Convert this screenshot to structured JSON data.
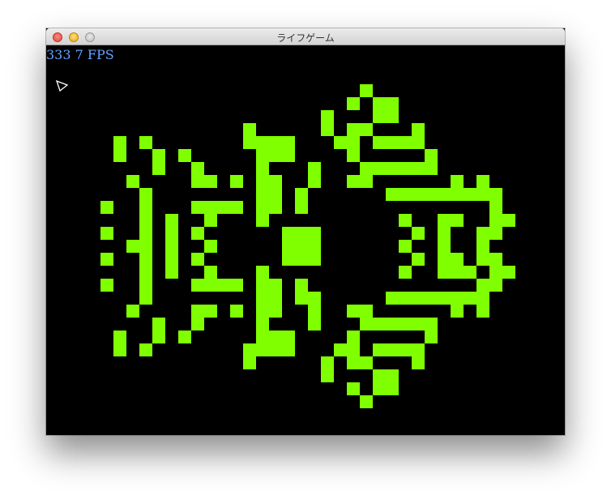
{
  "window": {
    "title": "ライフゲーム"
  },
  "hud": {
    "count": "333",
    "fps": "7 FPS"
  },
  "game": {
    "cell_color": "#80ff00",
    "background_color": "#000000",
    "live_cells": [
      [
        24,
        3
      ],
      [
        23,
        4
      ],
      [
        25,
        4
      ],
      [
        26,
        4
      ],
      [
        21,
        5
      ],
      [
        25,
        5
      ],
      [
        26,
        5
      ],
      [
        15,
        6
      ],
      [
        21,
        6
      ],
      [
        23,
        6
      ],
      [
        24,
        6
      ],
      [
        28,
        6
      ],
      [
        5,
        7
      ],
      [
        7,
        7
      ],
      [
        15,
        7
      ],
      [
        16,
        7
      ],
      [
        17,
        7
      ],
      [
        18,
        7
      ],
      [
        22,
        7
      ],
      [
        23,
        7
      ],
      [
        25,
        7
      ],
      [
        26,
        7
      ],
      [
        27,
        7
      ],
      [
        28,
        7
      ],
      [
        5,
        8
      ],
      [
        8,
        8
      ],
      [
        10,
        8
      ],
      [
        16,
        8
      ],
      [
        17,
        8
      ],
      [
        18,
        8
      ],
      [
        23,
        8
      ],
      [
        29,
        8
      ],
      [
        8,
        9
      ],
      [
        11,
        9
      ],
      [
        16,
        9
      ],
      [
        20,
        9
      ],
      [
        24,
        9
      ],
      [
        25,
        9
      ],
      [
        26,
        9
      ],
      [
        27,
        9
      ],
      [
        28,
        9
      ],
      [
        29,
        9
      ],
      [
        6,
        10
      ],
      [
        11,
        10
      ],
      [
        12,
        10
      ],
      [
        14,
        10
      ],
      [
        16,
        10
      ],
      [
        17,
        10
      ],
      [
        20,
        10
      ],
      [
        23,
        10
      ],
      [
        24,
        10
      ],
      [
        31,
        10
      ],
      [
        33,
        10
      ],
      [
        7,
        11
      ],
      [
        16,
        11
      ],
      [
        17,
        11
      ],
      [
        19,
        11
      ],
      [
        26,
        11
      ],
      [
        27,
        11
      ],
      [
        28,
        11
      ],
      [
        29,
        11
      ],
      [
        30,
        11
      ],
      [
        31,
        11
      ],
      [
        32,
        11
      ],
      [
        33,
        11
      ],
      [
        34,
        11
      ],
      [
        4,
        12
      ],
      [
        7,
        12
      ],
      [
        11,
        12
      ],
      [
        12,
        12
      ],
      [
        13,
        12
      ],
      [
        14,
        12
      ],
      [
        16,
        12
      ],
      [
        17,
        12
      ],
      [
        19,
        12
      ],
      [
        34,
        12
      ],
      [
        7,
        13
      ],
      [
        9,
        13
      ],
      [
        12,
        13
      ],
      [
        16,
        13
      ],
      [
        27,
        13
      ],
      [
        30,
        13
      ],
      [
        31,
        13
      ],
      [
        34,
        13
      ],
      [
        35,
        13
      ],
      [
        4,
        14
      ],
      [
        7,
        14
      ],
      [
        9,
        14
      ],
      [
        11,
        14
      ],
      [
        18,
        14
      ],
      [
        19,
        14
      ],
      [
        20,
        14
      ],
      [
        28,
        14
      ],
      [
        30,
        14
      ],
      [
        33,
        14
      ],
      [
        34,
        14
      ],
      [
        6,
        15
      ],
      [
        7,
        15
      ],
      [
        9,
        15
      ],
      [
        12,
        15
      ],
      [
        18,
        15
      ],
      [
        19,
        15
      ],
      [
        20,
        15
      ],
      [
        27,
        15
      ],
      [
        30,
        15
      ],
      [
        33,
        15
      ],
      [
        4,
        16
      ],
      [
        7,
        16
      ],
      [
        9,
        16
      ],
      [
        11,
        16
      ],
      [
        18,
        16
      ],
      [
        19,
        16
      ],
      [
        20,
        16
      ],
      [
        28,
        16
      ],
      [
        30,
        16
      ],
      [
        31,
        16
      ],
      [
        33,
        16
      ],
      [
        34,
        16
      ],
      [
        7,
        17
      ],
      [
        9,
        17
      ],
      [
        12,
        17
      ],
      [
        16,
        17
      ],
      [
        27,
        17
      ],
      [
        30,
        17
      ],
      [
        31,
        17
      ],
      [
        32,
        17
      ],
      [
        34,
        17
      ],
      [
        35,
        17
      ],
      [
        4,
        18
      ],
      [
        7,
        18
      ],
      [
        11,
        18
      ],
      [
        12,
        18
      ],
      [
        13,
        18
      ],
      [
        14,
        18
      ],
      [
        16,
        18
      ],
      [
        17,
        18
      ],
      [
        19,
        18
      ],
      [
        33,
        18
      ],
      [
        34,
        18
      ],
      [
        7,
        19
      ],
      [
        16,
        19
      ],
      [
        17,
        19
      ],
      [
        19,
        19
      ],
      [
        20,
        19
      ],
      [
        26,
        19
      ],
      [
        27,
        19
      ],
      [
        28,
        19
      ],
      [
        29,
        19
      ],
      [
        30,
        19
      ],
      [
        31,
        19
      ],
      [
        32,
        19
      ],
      [
        33,
        19
      ],
      [
        6,
        20
      ],
      [
        11,
        20
      ],
      [
        12,
        20
      ],
      [
        14,
        20
      ],
      [
        16,
        20
      ],
      [
        17,
        20
      ],
      [
        20,
        20
      ],
      [
        23,
        20
      ],
      [
        24,
        20
      ],
      [
        31,
        20
      ],
      [
        33,
        20
      ],
      [
        8,
        21
      ],
      [
        11,
        21
      ],
      [
        16,
        21
      ],
      [
        20,
        21
      ],
      [
        24,
        21
      ],
      [
        25,
        21
      ],
      [
        26,
        21
      ],
      [
        27,
        21
      ],
      [
        28,
        21
      ],
      [
        29,
        21
      ],
      [
        5,
        22
      ],
      [
        8,
        22
      ],
      [
        10,
        22
      ],
      [
        16,
        22
      ],
      [
        17,
        22
      ],
      [
        18,
        22
      ],
      [
        23,
        22
      ],
      [
        29,
        22
      ],
      [
        5,
        23
      ],
      [
        7,
        23
      ],
      [
        15,
        23
      ],
      [
        16,
        23
      ],
      [
        17,
        23
      ],
      [
        18,
        23
      ],
      [
        22,
        23
      ],
      [
        23,
        23
      ],
      [
        25,
        23
      ],
      [
        26,
        23
      ],
      [
        27,
        23
      ],
      [
        28,
        23
      ],
      [
        15,
        24
      ],
      [
        21,
        24
      ],
      [
        23,
        24
      ],
      [
        24,
        24
      ],
      [
        28,
        24
      ],
      [
        21,
        25
      ],
      [
        25,
        25
      ],
      [
        26,
        25
      ],
      [
        23,
        26
      ],
      [
        25,
        26
      ],
      [
        26,
        26
      ],
      [
        24,
        27
      ]
    ]
  }
}
